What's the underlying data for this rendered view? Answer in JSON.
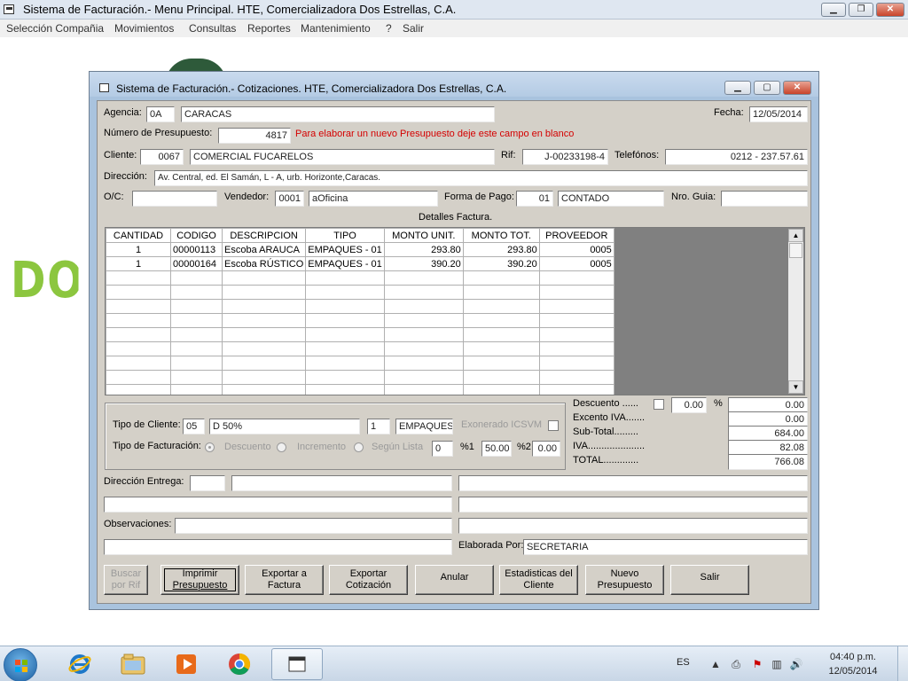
{
  "main_window": {
    "title": "Sistema de Facturación.- Menu Principal.    HTE, Comercializadora Dos Estrellas, C.A.",
    "controls": {
      "minimize": "▁",
      "restore": "❐",
      "close": "✕"
    }
  },
  "menu": [
    "Selección Compañia",
    "Movimientos",
    "Consultas",
    "Reportes",
    "Mantenimiento",
    "?",
    "Salir"
  ],
  "background_text": "DOS",
  "dialog": {
    "title": "Sistema de Facturación.- Cotizaciones.    HTE, Comercializadora Dos Estrellas, C.A.",
    "controls": {
      "minimize": "▁",
      "restore": "▢",
      "close": "✕"
    }
  },
  "form": {
    "agencia_label": "Agencia:",
    "agencia_code": "0A",
    "agencia_name": "CARACAS",
    "fecha_label": "Fecha:",
    "fecha_value": "12/05/2014",
    "presupuesto_label": "Número de Presupuesto:",
    "presupuesto_value": "4817",
    "presupuesto_hint": "Para elaborar un nuevo Presupuesto deje este campo en blanco",
    "cliente_label": "Cliente:",
    "cliente_code": "0067",
    "cliente_name": "COMERCIAL FUCARELOS",
    "rif_label": "Rif:",
    "rif_value": "J-00233198-4",
    "telefonos_label": "Telefónos:",
    "telefonos_value": "0212 - 237.57.61",
    "direccion_label": "Dirección:",
    "direccion_value": "Av. Central, ed. El Samán, L - A, urb. Horizonte,Caracas.",
    "oc_label": "O/C:",
    "oc_value": "",
    "vendedor_label": "Vendedor:",
    "vendedor_code": "0001",
    "vendedor_name": "aOficina",
    "forma_pago_label": "Forma de Pago:",
    "forma_pago_code": "01",
    "forma_pago_name": "CONTADO",
    "guia_label": "Nro. Guia:",
    "guia_value": "",
    "detalles_label": "Detalles Factura."
  },
  "grid": {
    "columns": [
      "CANTIDAD",
      "CODIGO",
      "DESCRIPCION",
      "TIPO",
      "MONTO UNIT.",
      "MONTO TOT.",
      "PROVEEDOR"
    ],
    "rows": [
      [
        "1",
        "00000113",
        "Escoba ARAUCA",
        "EMPAQUES - 01",
        "293.80",
        "293.80",
        "0005"
      ],
      [
        "1",
        "00000164",
        "Escoba RÚSTICO",
        "EMPAQUES - 01",
        "390.20",
        "390.20",
        "0005"
      ]
    ]
  },
  "client_panel": {
    "tipo_cliente_label": "Tipo de Cliente:",
    "tipo_cliente_code": "05",
    "tipo_cliente_name": "D 50%",
    "tipo_cliente_num": "1",
    "tipo_cliente_group": "EMPAQUES",
    "exonerado_label": "Exonerado ICSVM",
    "tipo_facturacion_label": "Tipo de Facturación:",
    "radio_descuento": "Descuento",
    "radio_incremento": "Incremento",
    "radio_segun_lista": "Según Lista",
    "lista_value": "0",
    "pct1_label": "%1",
    "pct1_value": "50.00",
    "pct2_label": "%2",
    "pct2_value": "0.00"
  },
  "totals": {
    "descuento_label": "Descuento ......",
    "descuento_pct": "0.00",
    "pct_sign": "%",
    "descuento_value": "0.00",
    "excento_label": "Excento IVA.......",
    "excento_value": "0.00",
    "subtotal_label": "Sub-Total.........",
    "subtotal_value": "684.00",
    "iva_label": "IVA.....................",
    "iva_value": "82.08",
    "total_label": "TOTAL.............",
    "total_value": "766.08"
  },
  "bottom": {
    "direccion_entrega_label": "Dirección Entrega:",
    "observaciones_label": "Observaciones:",
    "elaborada_label": "Elaborada Por:",
    "elaborada_value": "SECRETARIA"
  },
  "buttons": {
    "buscar": [
      "Buscar",
      "por Rif"
    ],
    "imprimir": [
      "Imprimir",
      "Presupuesto"
    ],
    "exportar_factura": [
      "Exportar a",
      "Factura"
    ],
    "exportar_cotizacion": [
      "Exportar",
      "Cotización"
    ],
    "anular": [
      "Anular"
    ],
    "estadisticas": [
      "Estadisticas del",
      "Cliente"
    ],
    "nuevo": [
      "Nuevo",
      "Presupuesto"
    ],
    "salir": [
      "Salir"
    ]
  },
  "taskbar": {
    "apps": [
      "internet-explorer",
      "file-explorer",
      "media-player",
      "chrome",
      "facturacion-app"
    ],
    "lang": "ES",
    "time": "04:40 p.m.",
    "date": "12/05/2014"
  }
}
